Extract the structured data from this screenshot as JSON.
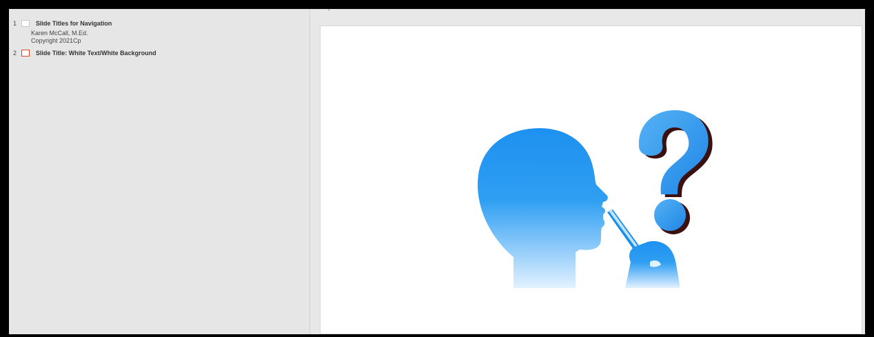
{
  "outline": {
    "slides": [
      {
        "number": "1",
        "title": "Slide Titles for Navigation",
        "lines": [
          "Karen McCall, M.Ed.",
          "Copyright 2021Cp"
        ],
        "selected": false
      },
      {
        "number": "2",
        "title": "Slide Title: White Text/White Background",
        "lines": [],
        "selected": true
      }
    ]
  },
  "slide": {
    "image_icons": [
      "head-silhouette-icon",
      "question-mark-icon",
      "pen-icon"
    ],
    "colors": {
      "accent_selected": "#e0461e",
      "head_top": "#1e90f0",
      "head_bottom": "#dff0ff",
      "question_mark": "#3aa0ee",
      "question_shadow": "#3a1010"
    }
  }
}
